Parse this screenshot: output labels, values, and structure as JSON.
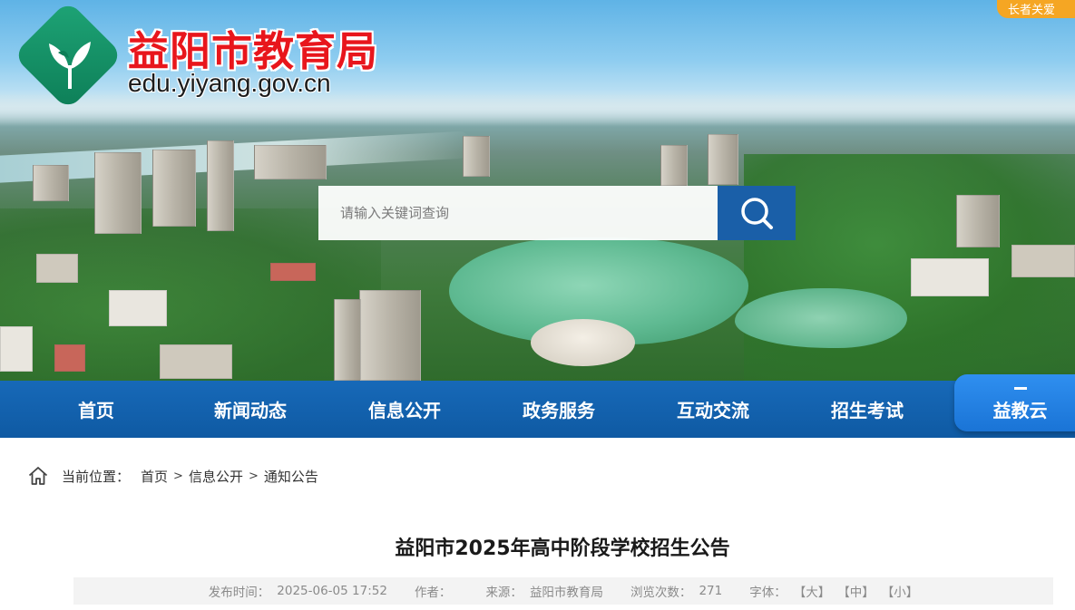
{
  "header": {
    "site_title": "益阳市教育局",
    "site_domain": "edu.yiyang.gov.cn",
    "elder_mode_label": "长者关爱"
  },
  "search": {
    "placeholder": "请输入关键词查询"
  },
  "nav": {
    "items": [
      {
        "label": "首页"
      },
      {
        "label": "新闻动态"
      },
      {
        "label": "信息公开"
      },
      {
        "label": "政务服务"
      },
      {
        "label": "互动交流"
      },
      {
        "label": "招生考试"
      }
    ],
    "special": {
      "label": "益教云"
    }
  },
  "breadcrumb": {
    "label": "当前位置：",
    "items": [
      "首页",
      "信息公开",
      "通知公告"
    ],
    "separator": ">"
  },
  "article": {
    "title": "益阳市2025年高中阶段学校招生公告",
    "publish_label": "发布时间：",
    "publish_time": "2025-06-05 17:52",
    "author_label": "作者：",
    "author": "",
    "source_label": "来源：",
    "source": "益阳市教育局",
    "views_label": "浏览次数：",
    "views": "271",
    "font_label": "字体：",
    "font_large": "【大】",
    "font_medium": "【中】",
    "font_small": "【小】"
  },
  "colors": {
    "title_red": "#e8161c",
    "nav_blue": "#1769b8",
    "search_btn_blue": "#1a5fa8",
    "elder_orange": "#f5a623",
    "logo_green": "#1ea476"
  },
  "icons": {
    "search": "search-icon",
    "home": "home-icon",
    "logo": "logo-emblem-icon"
  }
}
